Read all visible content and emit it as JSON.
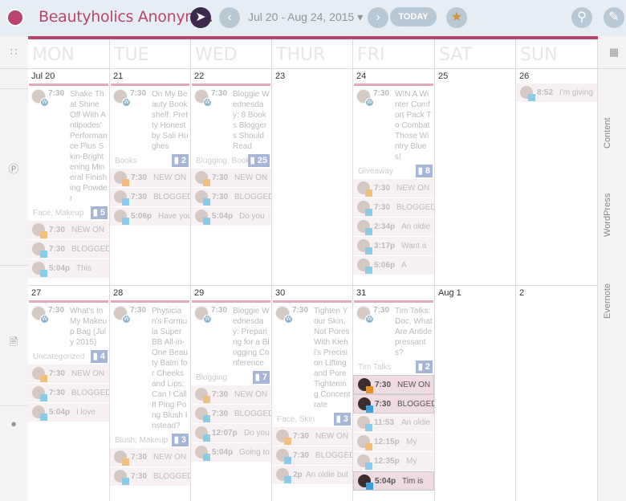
{
  "header": {
    "title": "Beautyholics Anonym...",
    "date_range": "Jul 20 - Aug 24, 2015",
    "today_label": "TODAY"
  },
  "weekdays": [
    "MON",
    "TUE",
    "WED",
    "THUR",
    "FRI",
    "SAT",
    "SUN"
  ],
  "right_panel": [
    "Content",
    "WordPress",
    "Evernote"
  ],
  "weeks": [
    [
      {
        "date": "Jul 20",
        "post": {
          "time": "7:30",
          "title": "Shake That Shine Off With Antipodes' Performance Plus Skin-Brightening Mineral Finishing Powder",
          "tags": "Face, Makeup",
          "count": "5"
        },
        "social": [
          {
            "t": "7:30",
            "x": "NEW ON",
            "o": 1
          },
          {
            "t": "7:30",
            "x": "BLOGGED"
          },
          {
            "t": "5:04p",
            "x": "This"
          }
        ]
      },
      {
        "date": "21",
        "post": {
          "time": "7:30",
          "title": "On My Beauty Bookshelf: Pretty Honest by Sali Hughes",
          "tags": "Books",
          "count": "2"
        },
        "social": [
          {
            "t": "7:30",
            "x": "NEW ON",
            "o": 1
          },
          {
            "t": "7:30",
            "x": "BLOGGED"
          },
          {
            "t": "5:06p",
            "x": "Have you"
          }
        ]
      },
      {
        "date": "22",
        "post": {
          "time": "7:30",
          "title": "Bloggie Wednesday: 8 Books Bloggers Should Read",
          "tags": "Blogging, Books",
          "count": "25"
        },
        "social": [
          {
            "t": "7:30",
            "x": "NEW ON",
            "o": 1
          },
          {
            "t": "7:30",
            "x": "BLOGGED"
          },
          {
            "t": "5:04p",
            "x": "Do you"
          }
        ]
      },
      {
        "date": "23",
        "social": []
      },
      {
        "date": "24",
        "post": {
          "time": "7:30",
          "title": "WIN A Winter Comfort Pack To Combat Those Wintry Blues!",
          "tags": "Giveaway",
          "count": "8"
        },
        "social": [
          {
            "t": "7:30",
            "x": "NEW ON",
            "o": 1
          },
          {
            "t": "7:30",
            "x": "BLOGGED"
          },
          {
            "t": "2:34p",
            "x": "An oldie"
          },
          {
            "t": "3:17p",
            "x": "Want a"
          },
          {
            "t": "5:06p",
            "x": "A"
          }
        ]
      },
      {
        "date": "25",
        "social": []
      },
      {
        "date": "26",
        "social": [
          {
            "t": "8:52",
            "x": "I'm giving"
          }
        ]
      }
    ],
    [
      {
        "date": "27",
        "post": {
          "time": "7:30",
          "title": "What's In My Makeup Bag (July 2015)",
          "tags": "Uncategorized",
          "count": "4"
        },
        "social": [
          {
            "t": "7:30",
            "x": "NEW ON",
            "o": 1
          },
          {
            "t": "7:30",
            "x": "BLOGGED"
          },
          {
            "t": "5:04p",
            "x": "I love"
          }
        ]
      },
      {
        "date": "28",
        "post": {
          "time": "7:30",
          "title": "Physician's Formula Super BB All-in-One Beauty Balm for Cheeks and Lips: Can I Call It Ping Pong Blush Instead?",
          "tags": "Blush, Makeup",
          "count": "3"
        },
        "social": [
          {
            "t": "7:30",
            "x": "NEW ON",
            "o": 1
          },
          {
            "t": "7:30",
            "x": "BLOGGED"
          }
        ]
      },
      {
        "date": "29",
        "post": {
          "time": "7:30",
          "title": "Bloggie Wednesday: Preparing for a Blogging Conference",
          "tags": "Blogging",
          "count": "7"
        },
        "social": [
          {
            "t": "7:30",
            "x": "NEW ON",
            "o": 1
          },
          {
            "t": "7:30",
            "x": "BLOGGED"
          },
          {
            "t": "12:07p",
            "x": "Do you"
          },
          {
            "t": "5:04p",
            "x": "Going to"
          }
        ]
      },
      {
        "date": "30",
        "post": {
          "time": "7:30",
          "title": "Tighten Your Skin, Not Pores With Kiehl's Precision Lifting and Pore Tightening Concentrate",
          "tags": "Face, Skin",
          "count": "3"
        },
        "social": [
          {
            "t": "7:30",
            "x": "NEW ON",
            "o": 1
          },
          {
            "t": "7:30",
            "x": "BLOGGED"
          },
          {
            "t": "2p",
            "x": "An oldie but"
          }
        ]
      },
      {
        "date": "31",
        "post": {
          "time": "7:30",
          "title": "Tim Talks: Doc, What Are Antidepressants?",
          "tags": "Tim Talks",
          "count": "2"
        },
        "social": [
          {
            "t": "7:30",
            "x": "NEW ON",
            "o": 1,
            "h": 1
          },
          {
            "t": "7:30",
            "x": "BLOGGED",
            "h": 1
          },
          {
            "t": "11:53",
            "x": "An oldie"
          },
          {
            "t": "12:15p",
            "x": "My",
            "o": 1
          },
          {
            "t": "12:35p",
            "x": "My"
          },
          {
            "t": "5:04p",
            "x": "Tim is",
            "h": 1
          }
        ]
      },
      {
        "date": "Aug 1",
        "social": []
      },
      {
        "date": "2",
        "social": []
      }
    ]
  ]
}
